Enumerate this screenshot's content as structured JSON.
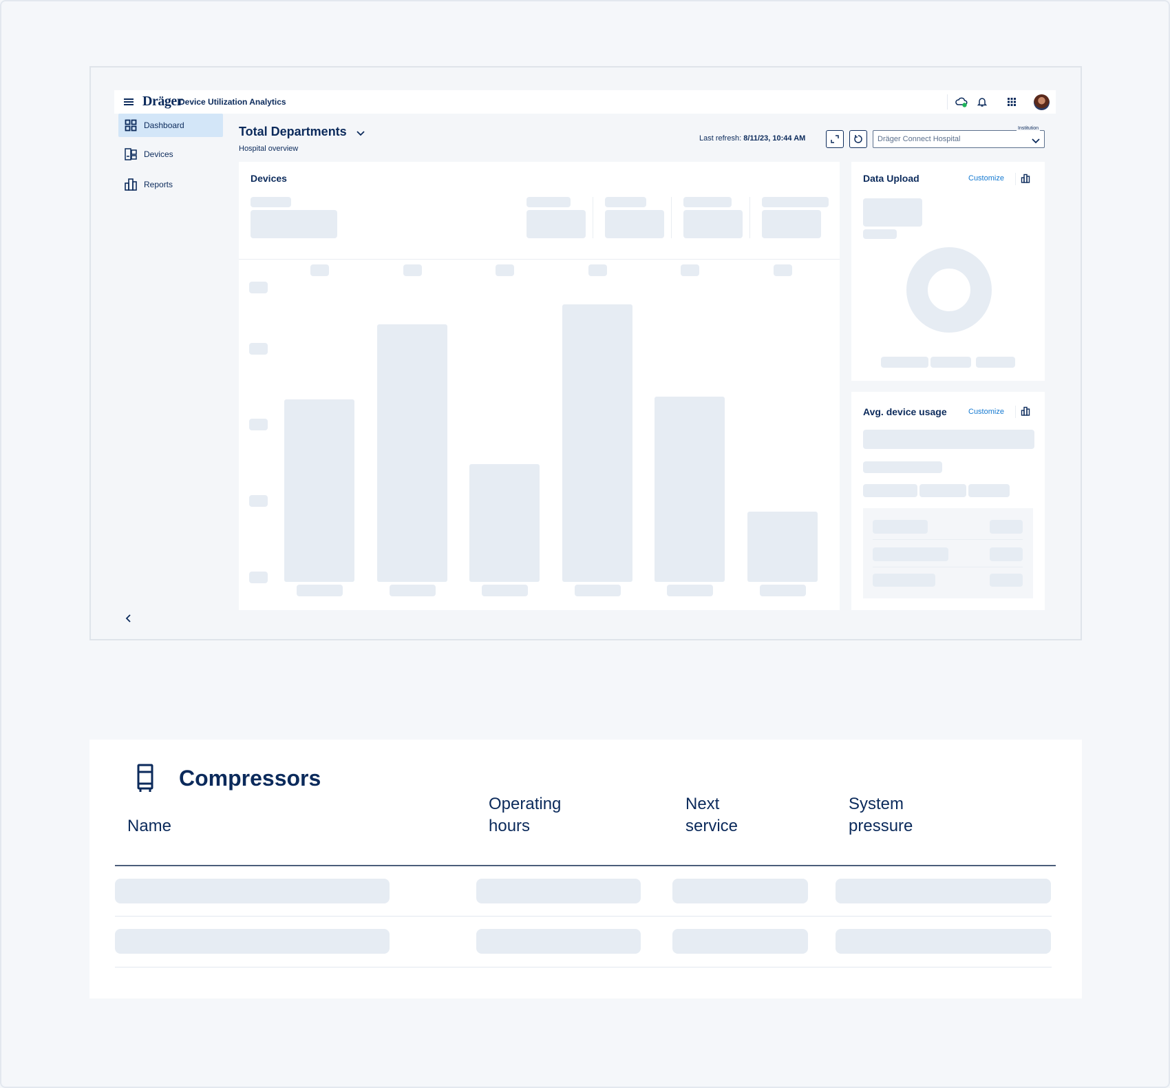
{
  "app": {
    "brand": "Dräger",
    "name": "Device Utilization Analytics"
  },
  "topbar": {
    "icons": [
      "menu-icon",
      "cloud-sync-icon",
      "bell-icon",
      "apps-grid-icon",
      "avatar"
    ]
  },
  "sidebar": {
    "items": [
      {
        "label": "Dashboard",
        "icon": "dashboard-icon",
        "active": true
      },
      {
        "label": "Devices",
        "icon": "devices-icon",
        "active": false
      },
      {
        "label": "Reports",
        "icon": "reports-icon",
        "active": false
      }
    ],
    "collapse_icon": "chevron-left-icon"
  },
  "header": {
    "title": "Total Departments",
    "subtitle": "Hospital overview",
    "last_refresh_label": "Last refresh:",
    "last_refresh_value": "8/11/23, 10:44 AM",
    "institution_label": "Institution",
    "institution_value": "Dräger Connect Hospital"
  },
  "cards": {
    "devices": {
      "title": "Devices"
    },
    "data_upload": {
      "title": "Data Upload",
      "customize": "Customize"
    },
    "avg_usage": {
      "title": "Avg. device usage",
      "customize": "Customize"
    }
  },
  "devices_chart_placeholder": {
    "bar_relative_heights": [
      0.65,
      0.92,
      0.42,
      0.99,
      0.66,
      0.25
    ]
  },
  "compressors": {
    "title": "Compressors",
    "icon": "compressor-icon",
    "columns": [
      [
        "Name"
      ],
      [
        "Operating",
        "hours"
      ],
      [
        "Next",
        "service"
      ],
      [
        "System",
        "pressure"
      ]
    ],
    "row_count": 2
  },
  "colors": {
    "primary": "#0b2a5b",
    "accent": "#1479d1",
    "active_nav": "#d3e6f8",
    "skeleton": "#e6ecf3",
    "status_ok": "#1fb35a"
  }
}
